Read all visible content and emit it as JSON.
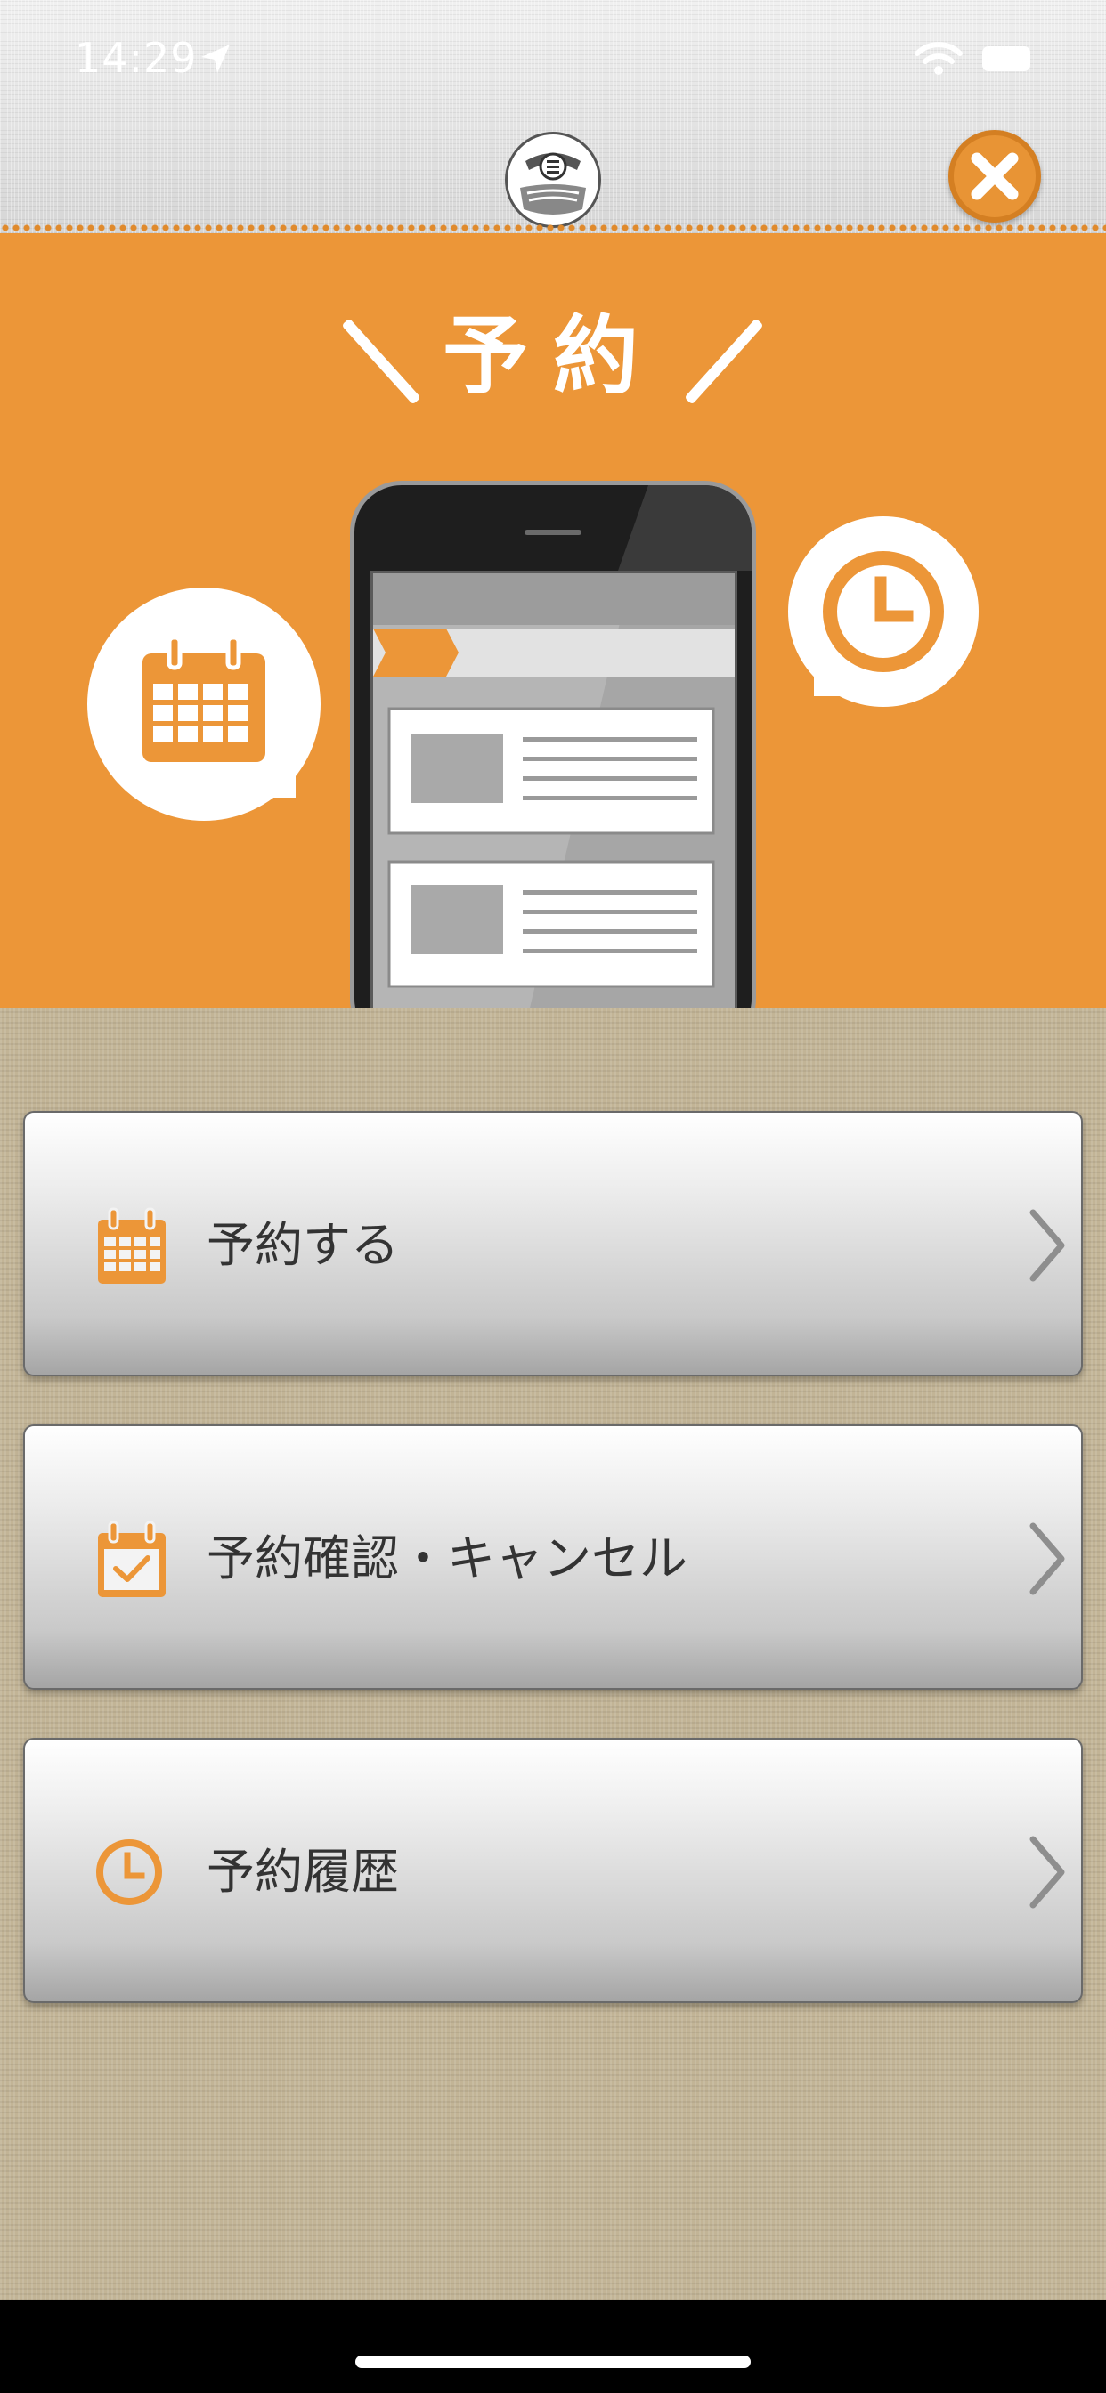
{
  "status_bar": {
    "time": "14:29"
  },
  "header": {
    "logo_icon": "shop-crest-logo",
    "close_icon": "close-x-icon"
  },
  "hero": {
    "title": "予約",
    "icons": [
      "calendar-icon",
      "clock-icon",
      "smartphone-illustration"
    ]
  },
  "menu": {
    "items": [
      {
        "label": "予約する",
        "icon": "calendar-icon"
      },
      {
        "label": "予約確認・キャンセル",
        "icon": "calendar-check-icon"
      },
      {
        "label": "予約履歴",
        "icon": "clock-icon"
      }
    ]
  },
  "colors": {
    "accent": "#ec9638",
    "button_text": "#333333",
    "background_cloth": "#c2b496"
  }
}
